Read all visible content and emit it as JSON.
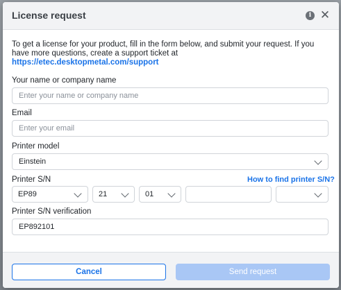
{
  "dialog": {
    "title": "License request",
    "info_icon": "info-icon",
    "close_icon": "close-icon"
  },
  "intro": {
    "text": "To get a license for your product, fill in the form below, and submit your request. If you have more questions, create a support ticket at",
    "link": "https://etec.desktopmetal.com/support"
  },
  "form": {
    "name_label": "Your name or company name",
    "name_placeholder": "Enter your name or company name",
    "email_label": "Email",
    "email_placeholder": "Enter your email",
    "model_label": "Printer model",
    "model_value": "Einstein",
    "sn_label": "Printer S/N",
    "sn_howto": "How to find printer S/N?",
    "sn_prefix": "EP89",
    "sn_part2": "21",
    "sn_part3": "01",
    "sn_part4": "",
    "sn_part5": "",
    "verification_label": "Printer S/N verification",
    "verification_value": "EP892101"
  },
  "footer": {
    "cancel_label": "Cancel",
    "send_label": "Send request"
  },
  "colors": {
    "accent": "#1a73e8",
    "disabled_button": "#a9c7f5"
  }
}
